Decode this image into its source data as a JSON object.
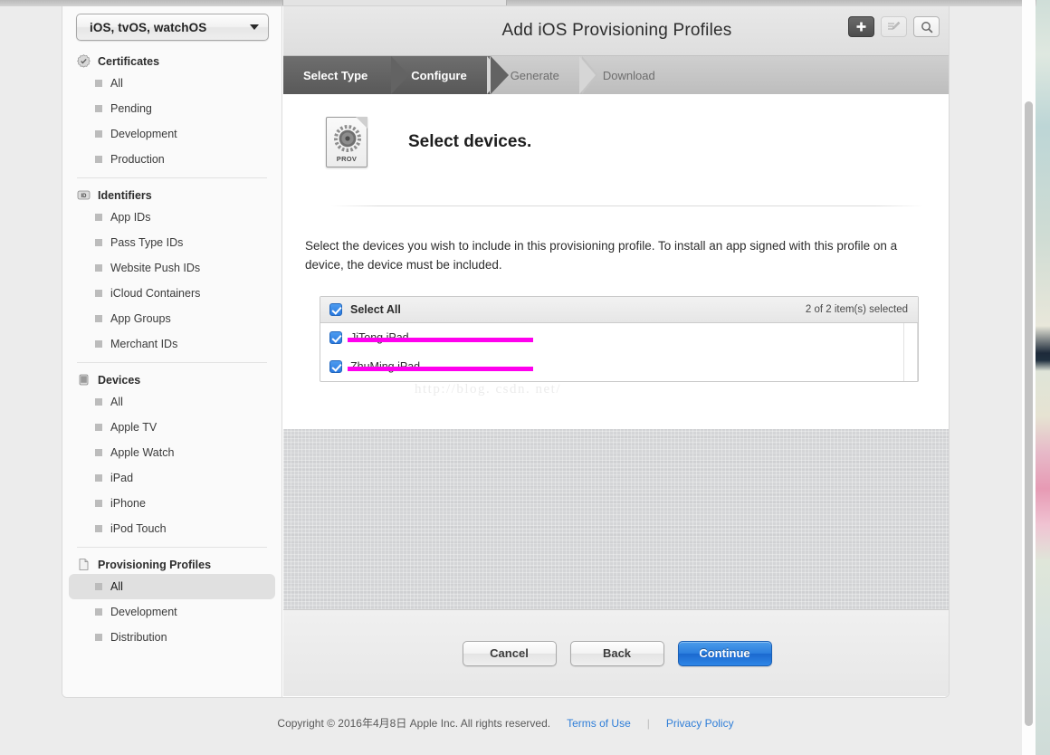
{
  "sidebar": {
    "sdk_popup": {
      "label": "iOS, tvOS, watchOS",
      "caret_icon": "chevron-down-icon"
    },
    "sections": [
      {
        "id": "certificates",
        "title": "Certificates",
        "icon": "certificate-seal-icon",
        "items": [
          {
            "label": "All",
            "selected": false
          },
          {
            "label": "Pending",
            "selected": false
          },
          {
            "label": "Development",
            "selected": false
          },
          {
            "label": "Production",
            "selected": false
          }
        ]
      },
      {
        "id": "identifiers",
        "title": "Identifiers",
        "icon": "id-badge-icon",
        "items": [
          {
            "label": "App IDs",
            "selected": false
          },
          {
            "label": "Pass Type IDs",
            "selected": false
          },
          {
            "label": "Website Push IDs",
            "selected": false
          },
          {
            "label": "iCloud Containers",
            "selected": false
          },
          {
            "label": "App Groups",
            "selected": false
          },
          {
            "label": "Merchant IDs",
            "selected": false
          }
        ]
      },
      {
        "id": "devices",
        "title": "Devices",
        "icon": "device-icon",
        "items": [
          {
            "label": "All",
            "selected": false
          },
          {
            "label": "Apple TV",
            "selected": false
          },
          {
            "label": "Apple Watch",
            "selected": false
          },
          {
            "label": "iPad",
            "selected": false
          },
          {
            "label": "iPhone",
            "selected": false
          },
          {
            "label": "iPod Touch",
            "selected": false
          }
        ]
      },
      {
        "id": "provisioning-profiles",
        "title": "Provisioning Profiles",
        "icon": "document-icon",
        "items": [
          {
            "label": "All",
            "selected": true
          },
          {
            "label": "Development",
            "selected": false
          },
          {
            "label": "Distribution",
            "selected": false
          }
        ]
      }
    ]
  },
  "header": {
    "title": "Add iOS Provisioning Profiles",
    "tools": [
      {
        "name": "add-button",
        "icon": "plus-icon",
        "state": "active"
      },
      {
        "name": "edit-button",
        "icon": "edit-pencil-icon",
        "state": "disabled"
      },
      {
        "name": "search-button",
        "icon": "search-icon",
        "state": "normal"
      }
    ]
  },
  "steps": [
    {
      "label": "Select Type",
      "state": "done"
    },
    {
      "label": "Configure",
      "state": "current"
    },
    {
      "label": "Generate",
      "state": "upcoming"
    },
    {
      "label": "Download",
      "state": "upcoming"
    }
  ],
  "main": {
    "doc_icon": {
      "name": "provisioning-profile-icon",
      "label": "PROV"
    },
    "heading": "Select devices.",
    "description": "Select the devices you wish to include in this provisioning profile. To install an app signed with this profile on a device, the device must be included.",
    "device_table": {
      "select_all_label": "Select All",
      "selection_summary": "2  of 2 item(s) selected",
      "rows": [
        {
          "name": "JiTong iPad",
          "checked": true,
          "redacted": true
        },
        {
          "name": "ZhuMing iPad",
          "checked": true,
          "redacted": true
        }
      ]
    },
    "watermark": "http://blog. csdn. net/"
  },
  "actions": {
    "cancel": "Cancel",
    "back": "Back",
    "continue": "Continue"
  },
  "footer": {
    "copyright": "Copyright © 2016年4月8日 Apple Inc. All rights reserved.",
    "terms": "Terms of Use",
    "divider": "|",
    "privacy": "Privacy Policy"
  },
  "colors": {
    "accent_blue": "#2b7ede",
    "redaction_magenta": "#ff00ee",
    "link_blue": "#2f7ed8",
    "step_dark": "#5d5d5d"
  }
}
